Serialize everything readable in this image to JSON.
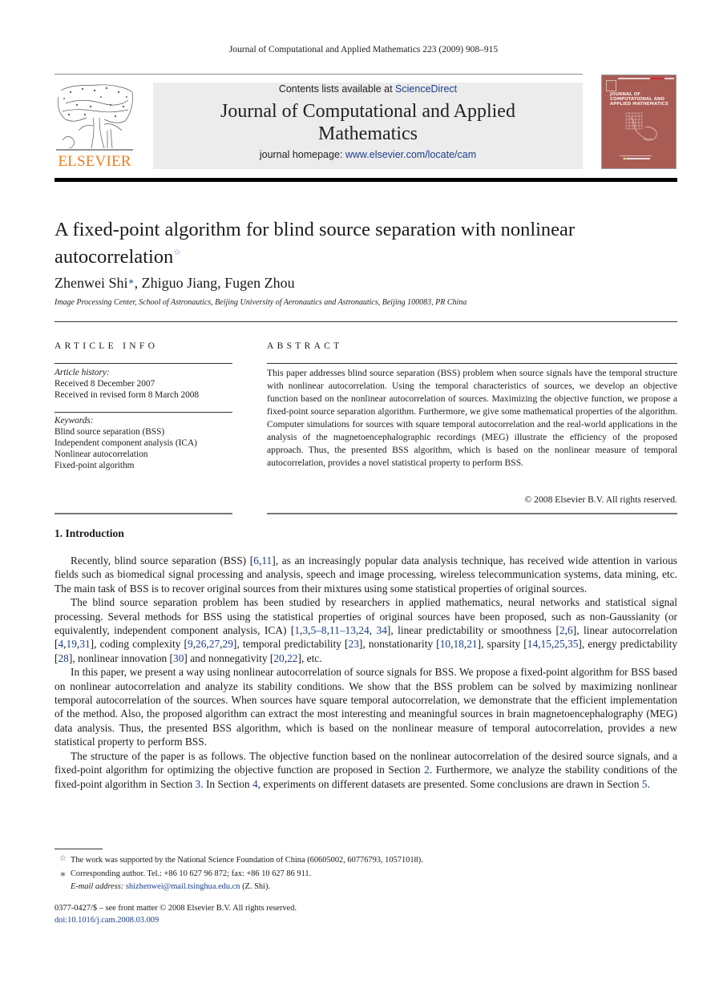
{
  "running_head": "Journal of Computational and Applied Mathematics 223 (2009) 908–915",
  "masthead": {
    "publisher": "ELSEVIER",
    "contents_prefix": "Contents lists available at ",
    "contents_link": "ScienceDirect",
    "journal_title_line1": "Journal of Computational and Applied",
    "journal_title_line2": "Mathematics",
    "homepage_prefix": "journal homepage: ",
    "homepage_link": "www.elsevier.com/locate/cam",
    "cover_title": "JOURNAL OF COMPUTATIONAL AND APPLIED MATHEMATICS",
    "colors": {
      "publisher_orange": "#f07d1c",
      "link_blue": "#1a3e8c",
      "cover_red": "#a95c54",
      "masthead_gray": "#ececec"
    }
  },
  "article": {
    "title": "A fixed-point algorithm for blind source separation with nonlinear autocorrelation",
    "title_note_mark": "☆",
    "authors": [
      {
        "name": "Zhenwei Shi",
        "mark": "∗"
      },
      {
        "name": "Zhiguo Jiang",
        "mark": ""
      },
      {
        "name": "Fugen Zhou",
        "mark": ""
      }
    ],
    "author_separator": ", ",
    "affiliation": "Image Processing Center, School of Astronautics, Beijing University of Aeronautics and Astronautics, Beijing 100083, PR China"
  },
  "article_info": {
    "label": "ARTICLE INFO",
    "history_head": "Article history:",
    "history": [
      "Received 8 December 2007",
      "Received in revised form 8 March 2008"
    ],
    "keywords_head": "Keywords:",
    "keywords": [
      "Blind source separation (BSS)",
      "Independent component analysis (ICA)",
      "Nonlinear autocorrelation",
      "Fixed-point algorithm"
    ]
  },
  "abstract": {
    "label": "ABSTRACT",
    "text": "This paper addresses blind source separation (BSS) problem when source signals have the temporal structure with nonlinear autocorrelation. Using the temporal characteristics of sources, we develop an objective function based on the nonlinear autocorrelation of sources. Maximizing the objective function, we propose a fixed-point source separation algorithm. Furthermore, we give some mathematical properties of the algorithm. Computer simulations for sources with square temporal autocorrelation and the real-world applications in the analysis of the magnetoencephalographic recordings (MEG) illustrate the efficiency of the proposed approach. Thus, the presented BSS algorithm, which is based on the nonlinear measure of temporal autocorrelation, provides a novel statistical property to perform BSS.",
    "copyright": "© 2008 Elsevier B.V. All rights reserved."
  },
  "introduction": {
    "heading": "1.  Introduction",
    "paragraphs": [
      [
        {
          "t": "Recently, blind source separation (BSS) ["
        },
        {
          "t": "6",
          "link": true
        },
        {
          "t": ","
        },
        {
          "t": "11",
          "link": true
        },
        {
          "t": "], as an increasingly popular data analysis technique, has received wide attention in various fields such as biomedical signal processing and analysis, speech and image processing, wireless telecommunication systems, data mining, etc. The main task of BSS is to recover original sources from their mixtures using some statistical properties of original sources."
        }
      ],
      [
        {
          "t": "The blind source separation problem has been studied by researchers in applied mathematics, neural networks and statistical signal processing. Several methods for BSS using the statistical properties of original sources have been proposed, such as non-Gaussianity (or equivalently, independent component analysis, ICA) ["
        },
        {
          "t": "1",
          "link": true
        },
        {
          "t": ","
        },
        {
          "t": "3",
          "link": true
        },
        {
          "t": ","
        },
        {
          "t": "5–8",
          "link": true
        },
        {
          "t": ","
        },
        {
          "t": "11–13",
          "link": true
        },
        {
          "t": ","
        },
        {
          "t": "24",
          "link": true
        },
        {
          "t": ", "
        },
        {
          "t": "34",
          "link": true
        },
        {
          "t": "], linear predictability or smoothness ["
        },
        {
          "t": "2",
          "link": true
        },
        {
          "t": ","
        },
        {
          "t": "6",
          "link": true
        },
        {
          "t": "], linear autocorrelation ["
        },
        {
          "t": "4",
          "link": true
        },
        {
          "t": ","
        },
        {
          "t": "19",
          "link": true
        },
        {
          "t": ","
        },
        {
          "t": "31",
          "link": true
        },
        {
          "t": "], coding complexity ["
        },
        {
          "t": "9",
          "link": true
        },
        {
          "t": ","
        },
        {
          "t": "26",
          "link": true
        },
        {
          "t": ","
        },
        {
          "t": "27",
          "link": true
        },
        {
          "t": ","
        },
        {
          "t": "29",
          "link": true
        },
        {
          "t": "], temporal predictability ["
        },
        {
          "t": "23",
          "link": true
        },
        {
          "t": "], nonstationarity ["
        },
        {
          "t": "10",
          "link": true
        },
        {
          "t": ","
        },
        {
          "t": "18",
          "link": true
        },
        {
          "t": ","
        },
        {
          "t": "21",
          "link": true
        },
        {
          "t": "], sparsity ["
        },
        {
          "t": "14",
          "link": true
        },
        {
          "t": ","
        },
        {
          "t": "15",
          "link": true
        },
        {
          "t": ","
        },
        {
          "t": "25",
          "link": true
        },
        {
          "t": ","
        },
        {
          "t": "35",
          "link": true
        },
        {
          "t": "], energy predictability ["
        },
        {
          "t": "28",
          "link": true
        },
        {
          "t": "], nonlinear innovation ["
        },
        {
          "t": "30",
          "link": true
        },
        {
          "t": "] and nonnegativity ["
        },
        {
          "t": "20",
          "link": true
        },
        {
          "t": ","
        },
        {
          "t": "22",
          "link": true
        },
        {
          "t": "], etc."
        }
      ],
      [
        {
          "t": "In this paper, we present a way using nonlinear autocorrelation of source signals for BSS. We propose a fixed-point algorithm for BSS based on nonlinear autocorrelation and analyze its stability conditions. We show that the BSS problem can be solved by maximizing nonlinear temporal autocorrelation of the sources. When sources have square temporal autocorrelation, we demonstrate that the efficient implementation of the method. Also, the proposed algorithm can extract the most interesting and meaningful sources in brain magnetoencephalography (MEG) data analysis. Thus, the presented BSS algorithm, which is based on the nonlinear measure of temporal autocorrelation, provides a new statistical property to perform BSS."
        }
      ],
      [
        {
          "t": "The structure of the paper is as follows. The objective function based on the nonlinear autocorrelation of the desired source signals, and a fixed-point algorithm for optimizing the objective function are proposed in Section "
        },
        {
          "t": "2",
          "link": true
        },
        {
          "t": ". Furthermore, we analyze the stability conditions of the fixed-point algorithm in Section "
        },
        {
          "t": "3",
          "link": true
        },
        {
          "t": ". In Section "
        },
        {
          "t": "4",
          "link": true
        },
        {
          "t": ", experiments on different datasets are presented. Some conclusions are drawn in Section "
        },
        {
          "t": "5",
          "link": true
        },
        {
          "t": "."
        }
      ]
    ]
  },
  "footnotes": {
    "funding_mark": "☆",
    "funding": "The work was supported by the National Science Foundation of China (60605002, 60776793, 10571018).",
    "corresponding_mark": "∗",
    "corresponding": "Corresponding author. Tel.: +86 10 627 96 872; fax: +86 10 627 86 911.",
    "email_label": "E-mail address: ",
    "email": "shizhenwei@mail.tsinghua.edu.cn",
    "email_suffix": " (Z. Shi)."
  },
  "front_matter": {
    "issn_line": "0377-0427/$ – see front matter © 2008 Elsevier B.V. All rights reserved.",
    "doi": "doi:10.1016/j.cam.2008.03.009"
  }
}
